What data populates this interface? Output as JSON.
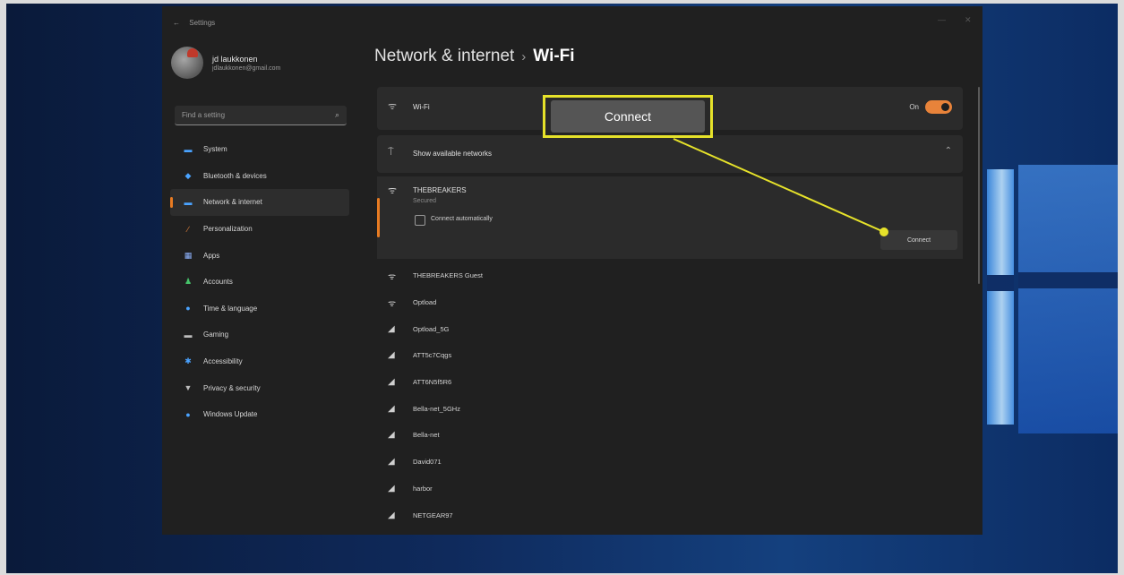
{
  "window": {
    "title": "Settings"
  },
  "profile": {
    "name": "jd laukkonen",
    "email": "jdlaukkonen@gmail.com"
  },
  "search": {
    "placeholder": "Find a setting"
  },
  "sidebar": {
    "items": [
      {
        "label": "System",
        "icon": "monitor-icon",
        "color": "#4aa3ff",
        "glyph": "▬"
      },
      {
        "label": "Bluetooth & devices",
        "icon": "bluetooth-icon",
        "color": "#4aa3ff",
        "glyph": "◆"
      },
      {
        "label": "Network & internet",
        "icon": "network-icon",
        "color": "#4aa3ff",
        "glyph": "▬",
        "active": true
      },
      {
        "label": "Personalization",
        "icon": "brush-icon",
        "color": "#e8833a",
        "glyph": "∕"
      },
      {
        "label": "Apps",
        "icon": "apps-icon",
        "color": "#8fb4ff",
        "glyph": "▦"
      },
      {
        "label": "Accounts",
        "icon": "person-icon",
        "color": "#46c46a",
        "glyph": "♟"
      },
      {
        "label": "Time & language",
        "icon": "globe-icon",
        "color": "#4aa3ff",
        "glyph": "●"
      },
      {
        "label": "Gaming",
        "icon": "gamepad-icon",
        "color": "#bdbdbd",
        "glyph": "▬"
      },
      {
        "label": "Accessibility",
        "icon": "accessibility-icon",
        "color": "#4aa3ff",
        "glyph": "✱"
      },
      {
        "label": "Privacy & security",
        "icon": "shield-icon",
        "color": "#bdbdbd",
        "glyph": "▼"
      },
      {
        "label": "Windows Update",
        "icon": "update-icon",
        "color": "#4aa3ff",
        "glyph": "●"
      }
    ]
  },
  "breadcrumb": {
    "parent": "Network & internet",
    "separator": "›",
    "current": "Wi-Fi"
  },
  "wifi": {
    "label": "Wi-Fi",
    "state": "On",
    "accent": "#e8833a"
  },
  "available": {
    "label": "Show available networks"
  },
  "expanded_network": {
    "name": "THEBREAKERS",
    "status": "Secured",
    "auto_label": "Connect automatically",
    "connect_label": "Connect"
  },
  "networks": [
    "THEBREAKERS Guest",
    "Optload",
    "Optload_5G",
    "ATT5c7Cqgs",
    "ATT6N5f5R6",
    "Bella-net_5GHz",
    "Bella-net",
    "David071",
    "harbor",
    "NETGEAR97"
  ],
  "callout": {
    "label": "Connect",
    "color": "#e6e22a"
  }
}
